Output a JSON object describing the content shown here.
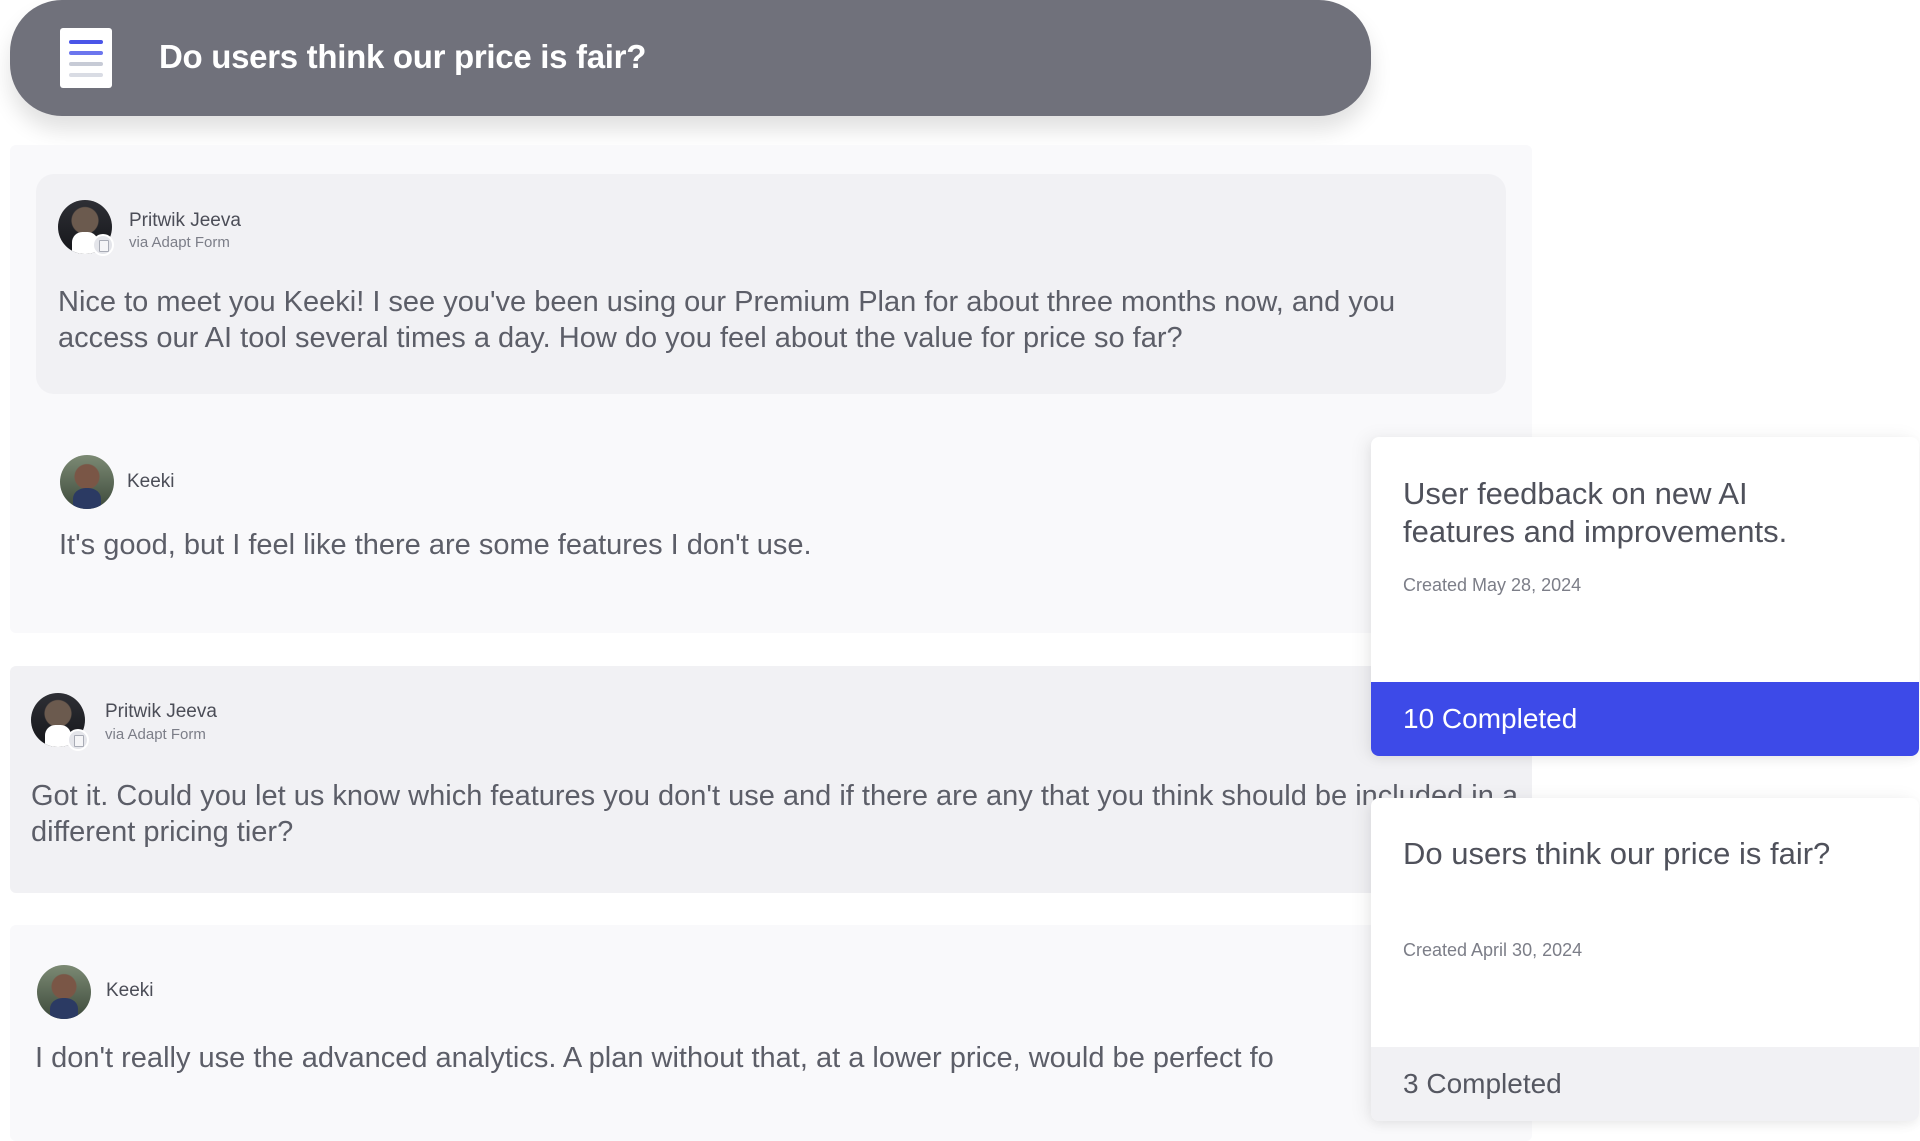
{
  "header": {
    "title": "Do users think our price is fair?",
    "icon": "document-icon"
  },
  "conversation": [
    {
      "author": "Pritwik Jeeva",
      "via": "via Adapt Form",
      "text": "Nice to meet you Keeki! I see you've been using our Premium Plan for about three months now, and you access our AI tool several times a day. How do you feel about the value for price so far?"
    },
    {
      "author": "Keeki",
      "text": "It's good, but I feel like there are some features I don't use."
    },
    {
      "author": "Pritwik Jeeva",
      "via": "via Adapt Form",
      "text": "Got it. Could you let us know which features you don't use and if there are any that you think should be included in a different pricing tier?"
    },
    {
      "author": "Keeki",
      "text": "I don't really use the advanced analytics. A plan without that, at a lower price, would be perfect fo"
    }
  ],
  "surveys": [
    {
      "title": "User feedback on new AI features and improvements.",
      "created": "Created May 28, 2024",
      "completed": "10 Completed",
      "accent": "#3d4ae8"
    },
    {
      "title": "Do users think our price is fair?",
      "created": "Created April 30, 2024",
      "completed": "3 Completed"
    }
  ]
}
